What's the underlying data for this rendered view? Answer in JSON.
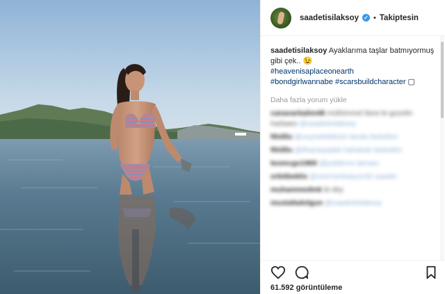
{
  "post": {
    "username": "saadetisilaksoy",
    "verified_mark": "✓",
    "dot": "•",
    "follow_label": "Takiptesin",
    "caption_text": "Ayaklarıma taşlar batmıyormuş gibi çek.. 😉",
    "hashtags": [
      "#heavenisaplaceonearth",
      "#bondgirlwannabe",
      "#scarsbuildcharacter"
    ],
    "caption_end": "▢",
    "load_more": "Daha fazla yorum yükle",
    "view_count": "61.592 görüntüleme"
  },
  "comments": [
    {
      "user": "canavarkalim48",
      "text": "müthimmel ibesi bi gozelin harbaeo",
      "mention": "@saadetisilaksoy"
    },
    {
      "user": "fthilllo",
      "text": "",
      "mention": "@zeynelebilirsin tanda farkettim"
    },
    {
      "user": "fthilllo",
      "text": "",
      "mention": "@ilhanaaadah hahahah farkettim"
    },
    {
      "user": "leomcgo1969",
      "text": "",
      "mention": "@judderno tamam"
    },
    {
      "user": "orbitbeklis",
      "text": "",
      "mention": "@seernimkatyon33 saadet"
    },
    {
      "user": "muhammedmk",
      "text": "bi dey",
      "mention": ""
    },
    {
      "user": "mustafadolgun",
      "text": "",
      "mention": "@saadetisilaksoy"
    }
  ],
  "icons": {
    "like": "heart-icon",
    "comment": "comment-icon",
    "save": "bookmark-icon",
    "avatar": "avatar"
  },
  "colors": {
    "link": "#003569",
    "verified": "#3897f0",
    "secondary": "#999999"
  }
}
